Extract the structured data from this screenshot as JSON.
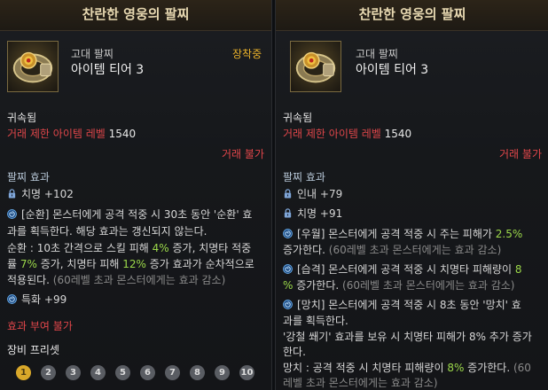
{
  "left": {
    "title": "찬란한 영웅의 팔찌",
    "grade": "고대 팔찌",
    "tier": "아이템 티어 3",
    "equipped": "장착중",
    "bound": "귀속됨",
    "level_label": "거래 제한 아이템 레벨",
    "level_value": "1540",
    "trade": "거래 불가",
    "effect_title": "팔찌 효과",
    "stat1": "치명 +102",
    "eff1_l1": "[순환] 몬스터에게 공격 적중 시 30초 동안 '순환' 효",
    "eff1_l2": "과를 획득한다. 해당 효과는 갱신되지 않는다.",
    "eff1_l3a": "순환 : 10초 간격으로 스킬 피해 ",
    "eff1_l3b": "4%",
    "eff1_l3c": " 증가, 치명타 적중",
    "eff1_l4a": "률 ",
    "eff1_l4b": "7%",
    "eff1_l4c": " 증가, 치명타 피해 ",
    "eff1_l4d": "12%",
    "eff1_l4e": " 증가 효과가 순차적으로",
    "eff1_l5a": "적용된다. ",
    "eff1_l5b": "(60레벨 초과 몬스터에게는 효과 감소)",
    "stat2": "특화 +99",
    "grant": "효과 부여 불가",
    "preset_label": "장비 프리셋",
    "presets": [
      "1",
      "2",
      "3",
      "4",
      "5",
      "6",
      "7",
      "8",
      "9",
      "10"
    ]
  },
  "right": {
    "title": "찬란한 영웅의 팔찌",
    "grade": "고대 팔찌",
    "tier": "아이템 티어 3",
    "bound": "귀속됨",
    "level_label": "거래 제한 아이템 레벨",
    "level_value": "1540",
    "trade": "거래 불가",
    "effect_title": "팔찌 효과",
    "stat1": "인내 +79",
    "stat2": "치명 +91",
    "e1_l1a": "[우월] 몬스터에게 공격 적중 시 주는 피해가 ",
    "e1_l1b": "2.5%",
    "e1_l2a": "증가한다. ",
    "e1_l2b": "(60레벨 초과 몬스터에게는 효과 감소)",
    "e2_l1a": "[습격] 몬스터에게 공격 적중 시 치명타 피해량이 ",
    "e2_l1b": "8",
    "e2_l2a": "%",
    "e2_l2b": " 증가한다. ",
    "e2_l2c": "(60레벨 초과 몬스터에게는 효과 감소)",
    "e3_l1": "[망치] 몬스터에게 공격 적중 시 8초 동안 '망치' 효",
    "e3_l2": "과를 획득한다.",
    "e3_l3": "'강철 쐐기' 효과를 보유 시 치명타 피해가 8% 추가 증가",
    "e3_l4": "한다.",
    "e3_l5a": "망치 : 공격 적중 시 치명타 피해량이 ",
    "e3_l5b": "8%",
    "e3_l5c": " 증가한다. ",
    "e3_l5d": "(60",
    "e3_l6": "레벨 초과 몬스터에게는 효과 감소)"
  }
}
